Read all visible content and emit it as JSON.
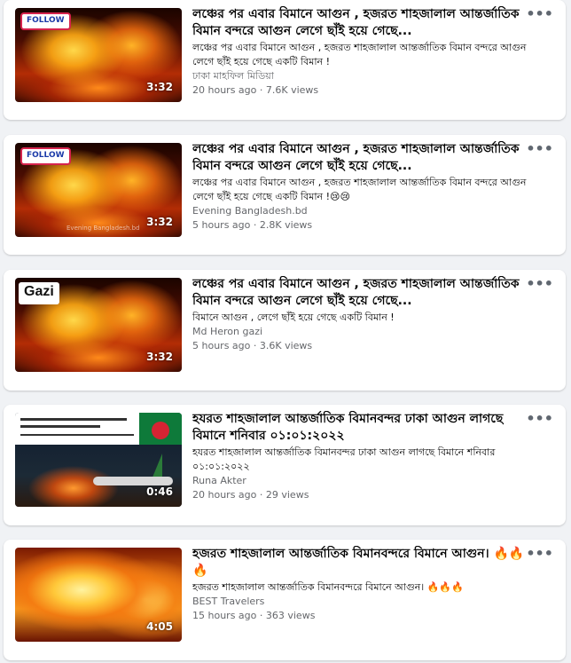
{
  "videos": [
    {
      "badge": "FOLLOW",
      "title": "লঞ্চের পর এবার বিমানে আগুন , হজরত শাহজালাল আন্তর্জাতিক বিমান বন্দরে আগুন লেগে ছাঁই হয়ে গেছে...",
      "description": "লঞ্চের পর এবার বিমানে আগুন , হজরত শাহজালাল আন্তর্জাতিক বিমান বন্দরে আগুন লেগে ছাঁই হয়ে গেছে একটি বিমান !",
      "channel": "ঢাকা মাহফিল মিডিয়া",
      "time": "20 hours ago",
      "views": "7.6K views",
      "duration": "3:32",
      "more_icon": "more-dots-icon"
    },
    {
      "badge": "FOLLOW",
      "watermark": "Evening Bangladesh.bd",
      "title": "লঞ্চের পর এবার বিমানে আগুন , হজরত শাহজালাল আন্তর্জাতিক বিমান বন্দরে আগুন লেগে ছাঁই হয়ে গেছে...",
      "description": "লঞ্চের পর এবার বিমানে আগুন , হজরত শাহজালাল আন্তর্জাতিক বিমান বন্দরে আগুন লেগে ছাঁই হয়ে গেছে একটি বিমান !😢😢",
      "channel": "Evening Bangladesh.bd",
      "time": "5 hours ago",
      "views": "2.8K views",
      "duration": "3:32"
    },
    {
      "badge": "Gazi",
      "title": "লঞ্চের পর এবার বিমানে আগুন , হজরত শাহজালাল আন্তর্জাতিক বিমান বন্দরে আগুন লেগে ছাঁই হয়ে গেছে...",
      "description": "বিমানে আগুন , লেগে ছাঁই হয়ে গেছে একটি বিমান !",
      "channel": "Md Heron gazi",
      "time": "5 hours ago",
      "views": "3.6K views",
      "duration": "3:32"
    },
    {
      "title": "হযরত শাহজালাল আন্তর্জাতিক বিমানবন্দর ঢাকা আগুন লাগছে বিমানে শনিবার ০১:০১:২০২২",
      "description": "হযরত শাহজালাল আন্তর্জাতিক বিমানবন্দর ঢাকা আগুন লাগছে বিমানে শনিবার ০১:০১:২০২২",
      "channel": "Runa Akter",
      "time": "20 hours ago",
      "views": "29 views",
      "duration": "0:46"
    },
    {
      "title": "হজরত শাহজালাল আন্তর্জাতিক বিমানবন্দরে বিমানে আগুন। 🔥🔥🔥",
      "description": "হজরত শাহজালাল আন্তর্জাতিক বিমানবন্দরে বিমানে আগুন। 🔥🔥🔥",
      "channel": "BEST Travelers",
      "time": "15 hours ago",
      "views": "363 views",
      "duration": "4:05"
    }
  ],
  "meta_separator": " · ",
  "more_label": "•••",
  "colors": {
    "background": "#f0f2f5",
    "card": "#ffffff",
    "secondary_text": "#65676b"
  }
}
